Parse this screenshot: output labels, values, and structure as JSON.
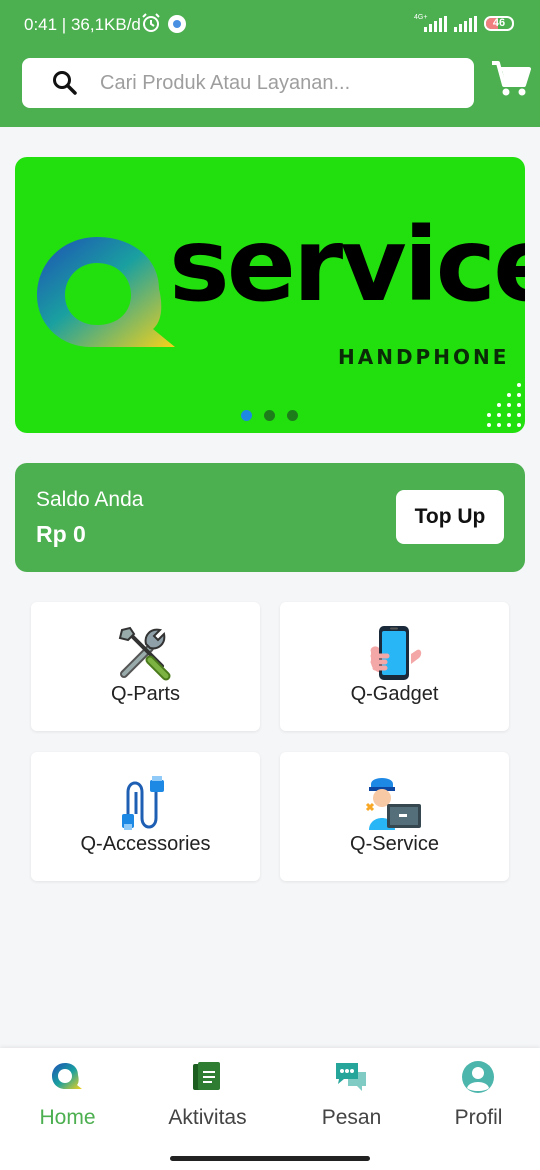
{
  "status_bar": {
    "time_speed": "0:41 | 36,1KB/d",
    "network_label": "4G+",
    "battery_level": "46",
    "battery_fraction": 0.46,
    "icons": [
      "alarm-icon",
      "app-indicator-icon",
      "signal-icon",
      "battery-icon"
    ]
  },
  "header": {
    "search_placeholder": "Cari Produk Atau Layanan...",
    "cart_icon": "cart-icon",
    "background_color": "#4caf50"
  },
  "banner": {
    "brand_word": "service",
    "brand_sub": "HANDPHONE",
    "slides": 3,
    "active_slide": 1,
    "background_color": "#22e00e"
  },
  "balance": {
    "label": "Saldo Anda",
    "amount": "Rp 0",
    "topup_label": "Top Up"
  },
  "menu": [
    {
      "label": "Q-Parts",
      "icon": "tools-icon"
    },
    {
      "label": "Q-Gadget",
      "icon": "phone-icon"
    },
    {
      "label": "Q-Accessories",
      "icon": "cable-icon"
    },
    {
      "label": "Q-Service",
      "icon": "technician-icon"
    }
  ],
  "bottom_nav": [
    {
      "label": "Home",
      "icon": "home-logo-icon",
      "active": true
    },
    {
      "label": "Aktivitas",
      "icon": "document-icon",
      "active": false
    },
    {
      "label": "Pesan",
      "icon": "chat-icon",
      "active": false
    },
    {
      "label": "Profil",
      "icon": "profile-icon",
      "active": false
    }
  ],
  "colors": {
    "accent": "#4caf50",
    "active_dot": "#1e88e5"
  }
}
